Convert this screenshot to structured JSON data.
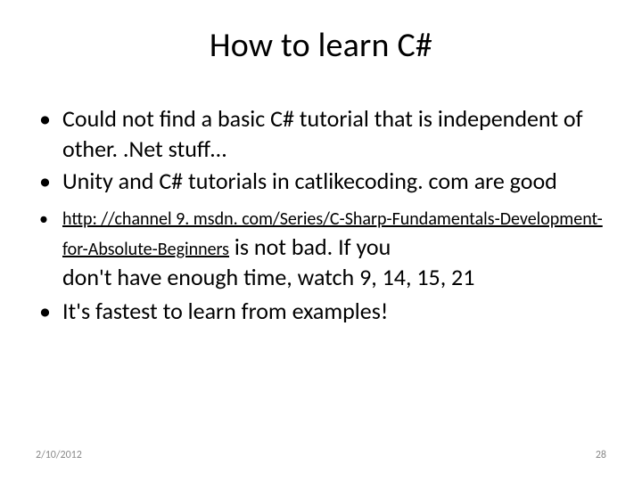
{
  "title": "How to learn C#",
  "bullets": {
    "b1": "Could not find a basic C# tutorial that is independent of other. .Net stuff…",
    "b2": "Unity and C# tutorials in catlikecoding. com are good",
    "b3_link": "http: //channel 9. msdn. com/Series/C-Sharp-Fundamentals-Development-for-Absolute-Beginners",
    "b3_trail1": " is not bad. If you ",
    "b3_trail2": "don't have enough time, watch 9, 14, 15, 21",
    "b4": "It's fastest to learn from examples!"
  },
  "footer": {
    "date": "2/10/2012",
    "page": "28"
  },
  "bullet_char": "•"
}
